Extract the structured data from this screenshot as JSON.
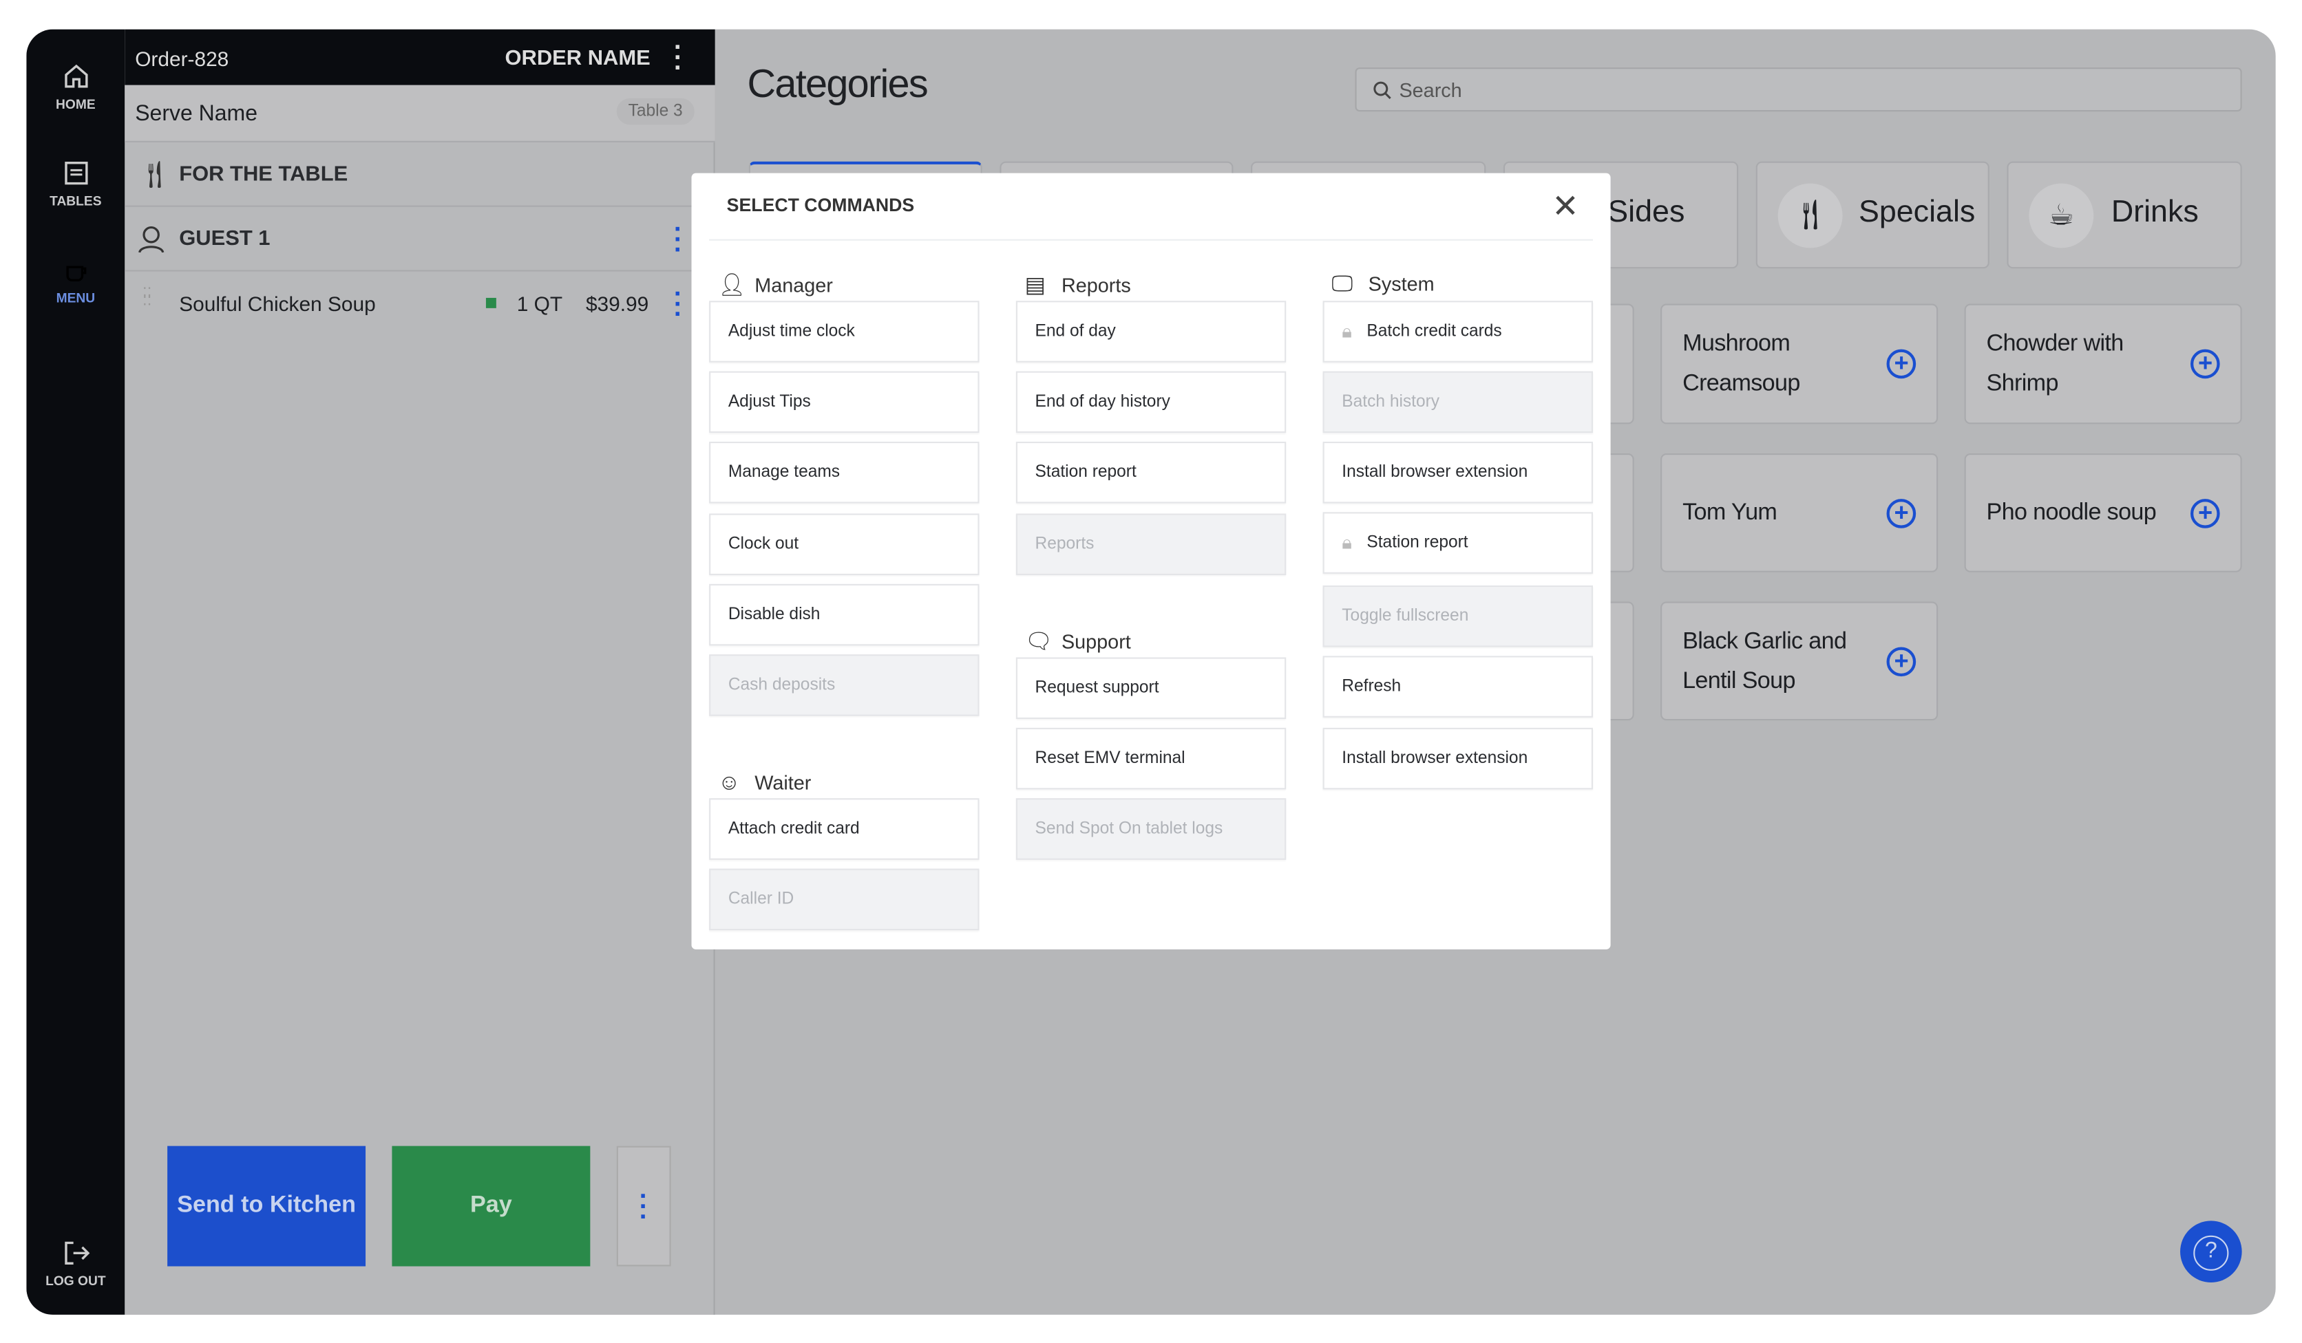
{
  "sidebar": {
    "items": [
      {
        "label": "HOME",
        "icon": "home-icon"
      },
      {
        "label": "TABLES",
        "icon": "receipt-icon"
      },
      {
        "label": "MENU",
        "icon": "coffee-icon",
        "active": true
      },
      {
        "label": "LOG OUT",
        "icon": "logout-icon"
      }
    ]
  },
  "order": {
    "id": "Order-828",
    "name_label": "ORDER NAME",
    "serve_name": "Serve Name",
    "table": "Table 3",
    "for_the_table": "FOR THE TABLE",
    "guest": "GUEST 1",
    "items": [
      {
        "name": "Soulful Chicken Soup",
        "qty": "1 QT",
        "price": "$39.99",
        "status_color": "#2a8a4a"
      }
    ],
    "send_label": "Send to Kitchen",
    "pay_label": "Pay"
  },
  "main": {
    "title": "Categories",
    "search_placeholder": "Search",
    "categories": [
      {
        "label": ""
      },
      {
        "label": ""
      },
      {
        "label": ""
      },
      {
        "label": "Sides"
      },
      {
        "label": "Specials",
        "icon": "fork-knife-icon"
      },
      {
        "label": "Drinks",
        "icon": "coffee-cup-icon"
      }
    ],
    "items": [
      {
        "name": "Mushroom Creamsoup"
      },
      {
        "name": "Chowder with Shrimp"
      },
      {
        "name": "Tom Yum"
      },
      {
        "name": "Pho noodle soup"
      },
      {
        "name": "Black Garlic and Lentil Soup"
      }
    ]
  },
  "modal": {
    "title": "SELECT COMMANDS",
    "manager": {
      "label": "Manager",
      "commands": [
        {
          "label": "Adjust time clock"
        },
        {
          "label": "Adjust Tips"
        },
        {
          "label": "Manage teams"
        },
        {
          "label": "Clock out"
        },
        {
          "label": "Disable dish"
        },
        {
          "label": "Cash deposits",
          "disabled": true
        }
      ]
    },
    "waiter": {
      "label": "Waiter",
      "commands": [
        {
          "label": "Attach credit card"
        },
        {
          "label": "Caller ID",
          "disabled": true
        }
      ]
    },
    "reports": {
      "label": "Reports",
      "commands": [
        {
          "label": "End of day"
        },
        {
          "label": "End of day history"
        },
        {
          "label": "Station report"
        },
        {
          "label": "Reports",
          "disabled": true
        }
      ]
    },
    "support": {
      "label": "Support",
      "commands": [
        {
          "label": "Request support"
        },
        {
          "label": "Reset EMV terminal"
        },
        {
          "label": "Send Spot On tablet logs",
          "disabled": true
        }
      ]
    },
    "system": {
      "label": "System",
      "commands": [
        {
          "label": "Batch credit cards",
          "locked": true
        },
        {
          "label": "Batch history",
          "disabled": true
        },
        {
          "label": "Install browser extension"
        },
        {
          "label": "Station report",
          "locked": true
        },
        {
          "label": "Toggle fullscreen",
          "disabled": true
        },
        {
          "label": "Refresh"
        },
        {
          "label": "Install browser extension"
        }
      ]
    }
  },
  "colors": {
    "accent": "#1a4fd0",
    "pay": "#2a8a4a",
    "sidebar": "#0a0c10"
  }
}
